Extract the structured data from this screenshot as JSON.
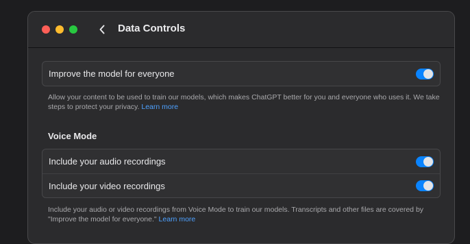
{
  "window": {
    "title": "Data Controls"
  },
  "improve": {
    "label": "Improve the model for everyone",
    "enabled": true,
    "description": "Allow your content to be used to train our models, which makes ChatGPT better for you and everyone who uses it. We take steps to protect your privacy.",
    "learn_more": "Learn more"
  },
  "voice_mode": {
    "heading": "Voice Mode",
    "items": [
      {
        "label": "Include your audio recordings",
        "enabled": true
      },
      {
        "label": "Include your video recordings",
        "enabled": true
      }
    ],
    "description": "Include your audio or video recordings from Voice Mode to train our models. Transcripts and other files are covered by \"Improve the model for everyone.\"",
    "learn_more": "Learn more"
  },
  "colors": {
    "accent": "#0a84ff",
    "link": "#4ea1ff",
    "traffic_red": "#ff5f57",
    "traffic_yellow": "#febc2e",
    "traffic_green": "#28c840"
  },
  "icons": {
    "back": "chevron-left-icon"
  }
}
